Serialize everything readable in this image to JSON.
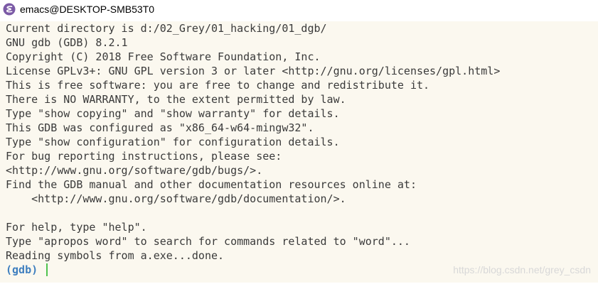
{
  "window": {
    "title": "emacs@DESKTOP-SMB53T0",
    "icon": "emacs-icon",
    "accent_colors": {
      "icon": "#7b5aa6",
      "background": "#fbf8ef",
      "text": "#3a3a3a",
      "prompt": "#3f7fbf",
      "cursor": "#4fc34f"
    }
  },
  "terminal": {
    "lines": [
      "Current directory is d:/02_Grey/01_hacking/01_dgb/",
      "GNU gdb (GDB) 8.2.1",
      "Copyright (C) 2018 Free Software Foundation, Inc.",
      "License GPLv3+: GNU GPL version 3 or later <http://gnu.org/licenses/gpl.html>",
      "This is free software: you are free to change and redistribute it.",
      "There is NO WARRANTY, to the extent permitted by law.",
      "Type \"show copying\" and \"show warranty\" for details.",
      "This GDB was configured as \"x86_64-w64-mingw32\".",
      "Type \"show configuration\" for configuration details.",
      "For bug reporting instructions, please see:",
      "<http://www.gnu.org/software/gdb/bugs/>.",
      "Find the GDB manual and other documentation resources online at:",
      "    <http://www.gnu.org/software/gdb/documentation/>.",
      "",
      "For help, type \"help\".",
      "Type \"apropos word\" to search for commands related to \"word\"...",
      "Reading symbols from a.exe...done."
    ],
    "prompt": "(gdb)"
  },
  "watermark": "https://blog.csdn.net/grey_csdn"
}
